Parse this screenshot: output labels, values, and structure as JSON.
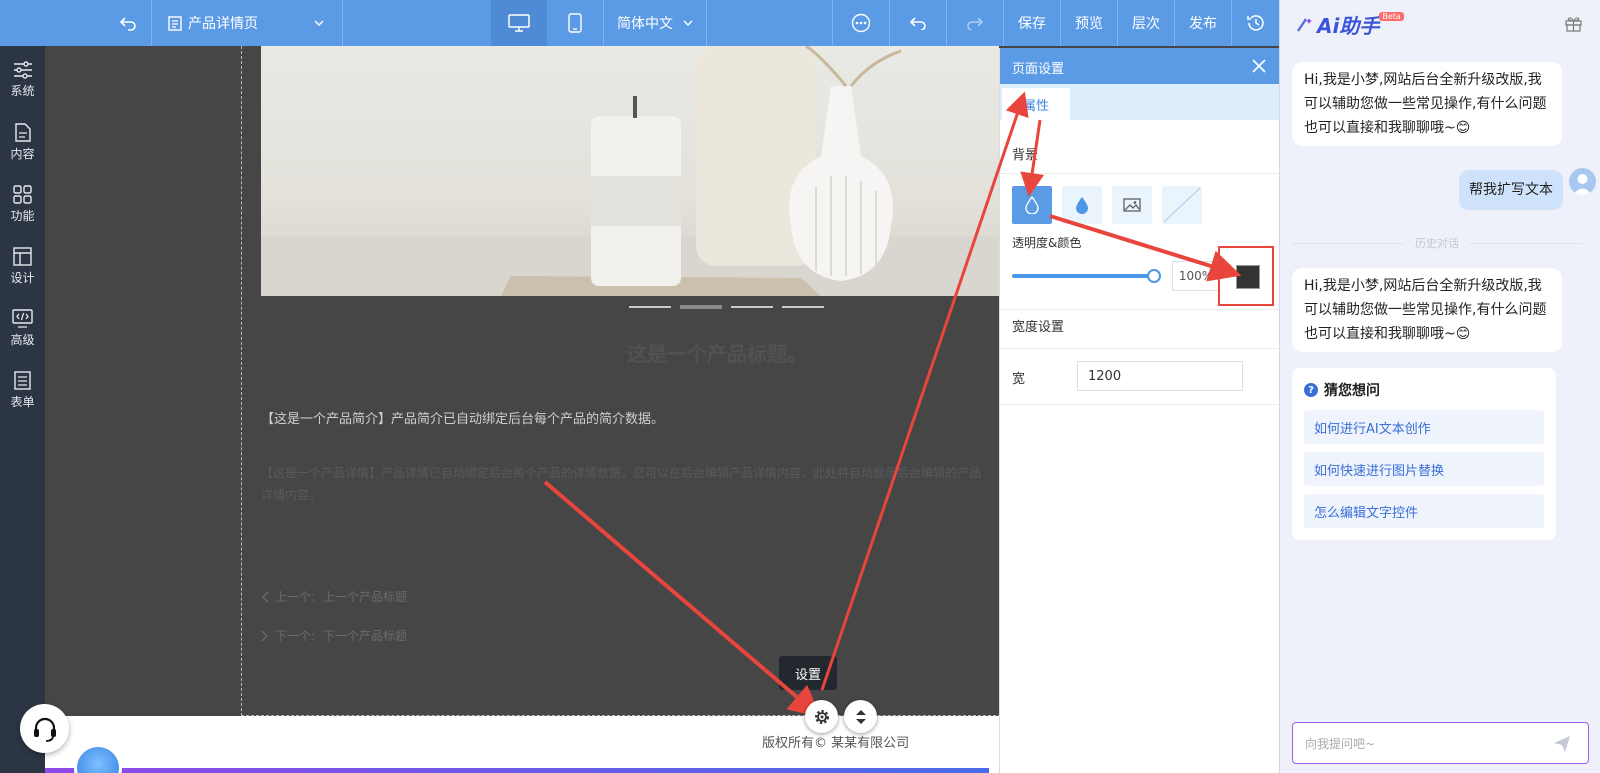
{
  "topbar": {
    "page_select": "产品详情页",
    "language_select": "简体中文",
    "save": "保存",
    "preview": "预览",
    "layers": "层次",
    "publish": "发布"
  },
  "leftnav": {
    "items": [
      {
        "label": "系统",
        "icon": "sliders-icon"
      },
      {
        "label": "内容",
        "icon": "document-icon"
      },
      {
        "label": "功能",
        "icon": "grid-icon"
      },
      {
        "label": "设计",
        "icon": "layout-icon"
      },
      {
        "label": "高级",
        "icon": "code-icon"
      },
      {
        "label": "表单",
        "icon": "form-icon"
      }
    ]
  },
  "canvas": {
    "product_title": "这是一个产品标题。",
    "product_summary": "【这是一个产品简介】产品简介已自动绑定后台每个产品的简介数据。",
    "product_detail": "【这是一个产品详情】产品详情已自动绑定后台每个产品的详情数据，您可以在后台编辑产品详情内容，此处将自动显示后台编辑的产品详情内容。",
    "prev_label": "上一个:",
    "prev_title": "上一个产品标题",
    "next_label": "下一个:",
    "next_title": "下一个产品标题",
    "tooltip": "设置",
    "copyright": "版权所有© 某某有限公司"
  },
  "panel": {
    "title": "页面设置",
    "tab": "属性",
    "background_label": "背景",
    "opacity_color_label": "透明度&颜色",
    "opacity_value": "100%",
    "opacity_level": 1.0,
    "color_swatch": "#333333",
    "width_section": "宽度设置",
    "width_label": "宽",
    "width_value": "1200"
  },
  "ai": {
    "title": "Ai助手",
    "badge": "Beta",
    "greeting": "Hi,我是小梦,网站后台全新升级改版,我可以辅助您做一些常见操作,有什么问题也可以直接和我聊聊哦~😊",
    "user_message": "帮我扩写文本",
    "history_divider": "历史对话",
    "greeting_2": "Hi,我是小梦,网站后台全新升级改版,我可以辅助您做一些常见操作,有什么问题也可以直接和我聊聊哦~😊",
    "guess_title": "猜您想问",
    "suggestions": [
      "如何进行AI文本创作",
      "如何快速进行图片替换",
      "怎么编辑文字控件"
    ],
    "input_placeholder": "向我提问吧~"
  },
  "colors": {
    "topbar": "#5b9be6",
    "leftnav": "#2c3544",
    "canvas_bg": "#464646",
    "annotation_red": "#e8453c",
    "accent_blue": "#3a6fd8"
  }
}
